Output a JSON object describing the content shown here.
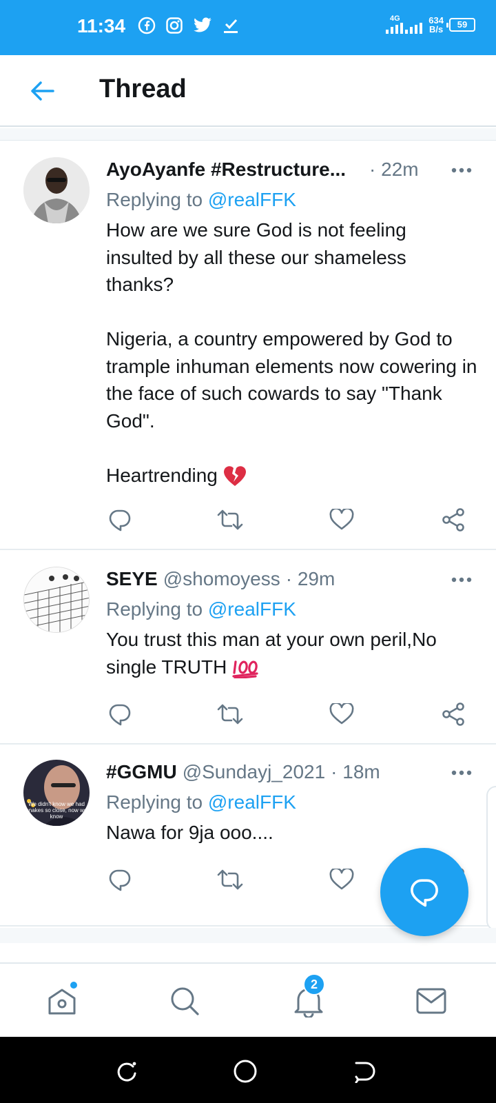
{
  "status_bar": {
    "time": "11:34",
    "network": "4G",
    "speed_value": "634",
    "speed_unit": "B/s",
    "battery": "59",
    "icons": [
      "facebook-icon",
      "instagram-icon",
      "twitter-icon",
      "check-download-icon"
    ]
  },
  "header": {
    "title": "Thread"
  },
  "tweets": [
    {
      "name": "AyoAyanfe #Restructure...",
      "handle": "",
      "time": "· 22m",
      "reply_prefix": "Replying to ",
      "reply_to": "@realFFK",
      "body": "How are we sure God is not feeling insulted by all these our shameless thanks?\n\nNigeria, a country empowered by God to trample inhuman elements now cowering in the face of such cowards to say \"Thank God\".\n\nHeartrending",
      "emoji": "broken-heart-emoji"
    },
    {
      "name": "SEYE",
      "handle": "@shomoyess",
      "time": "· 29m",
      "reply_prefix": "Replying to ",
      "reply_to": "@realFFK",
      "body": "You trust this man at your own peril,No single TRUTH",
      "emoji": "hundred-points-emoji"
    },
    {
      "name": "#GGMU",
      "handle": "@Sundayj_2021",
      "time": "· 18m",
      "reply_prefix": "Replying to ",
      "reply_to": "@realFFK",
      "body": "Nawa for 9ja ooo....",
      "avatar_text": "We didn't know we had snakes so close, now we know"
    }
  ],
  "bottom_nav": {
    "notifications_badge": "2"
  },
  "colors": {
    "accent": "#1da1f2",
    "text": "#14171a",
    "muted": "#657786"
  }
}
